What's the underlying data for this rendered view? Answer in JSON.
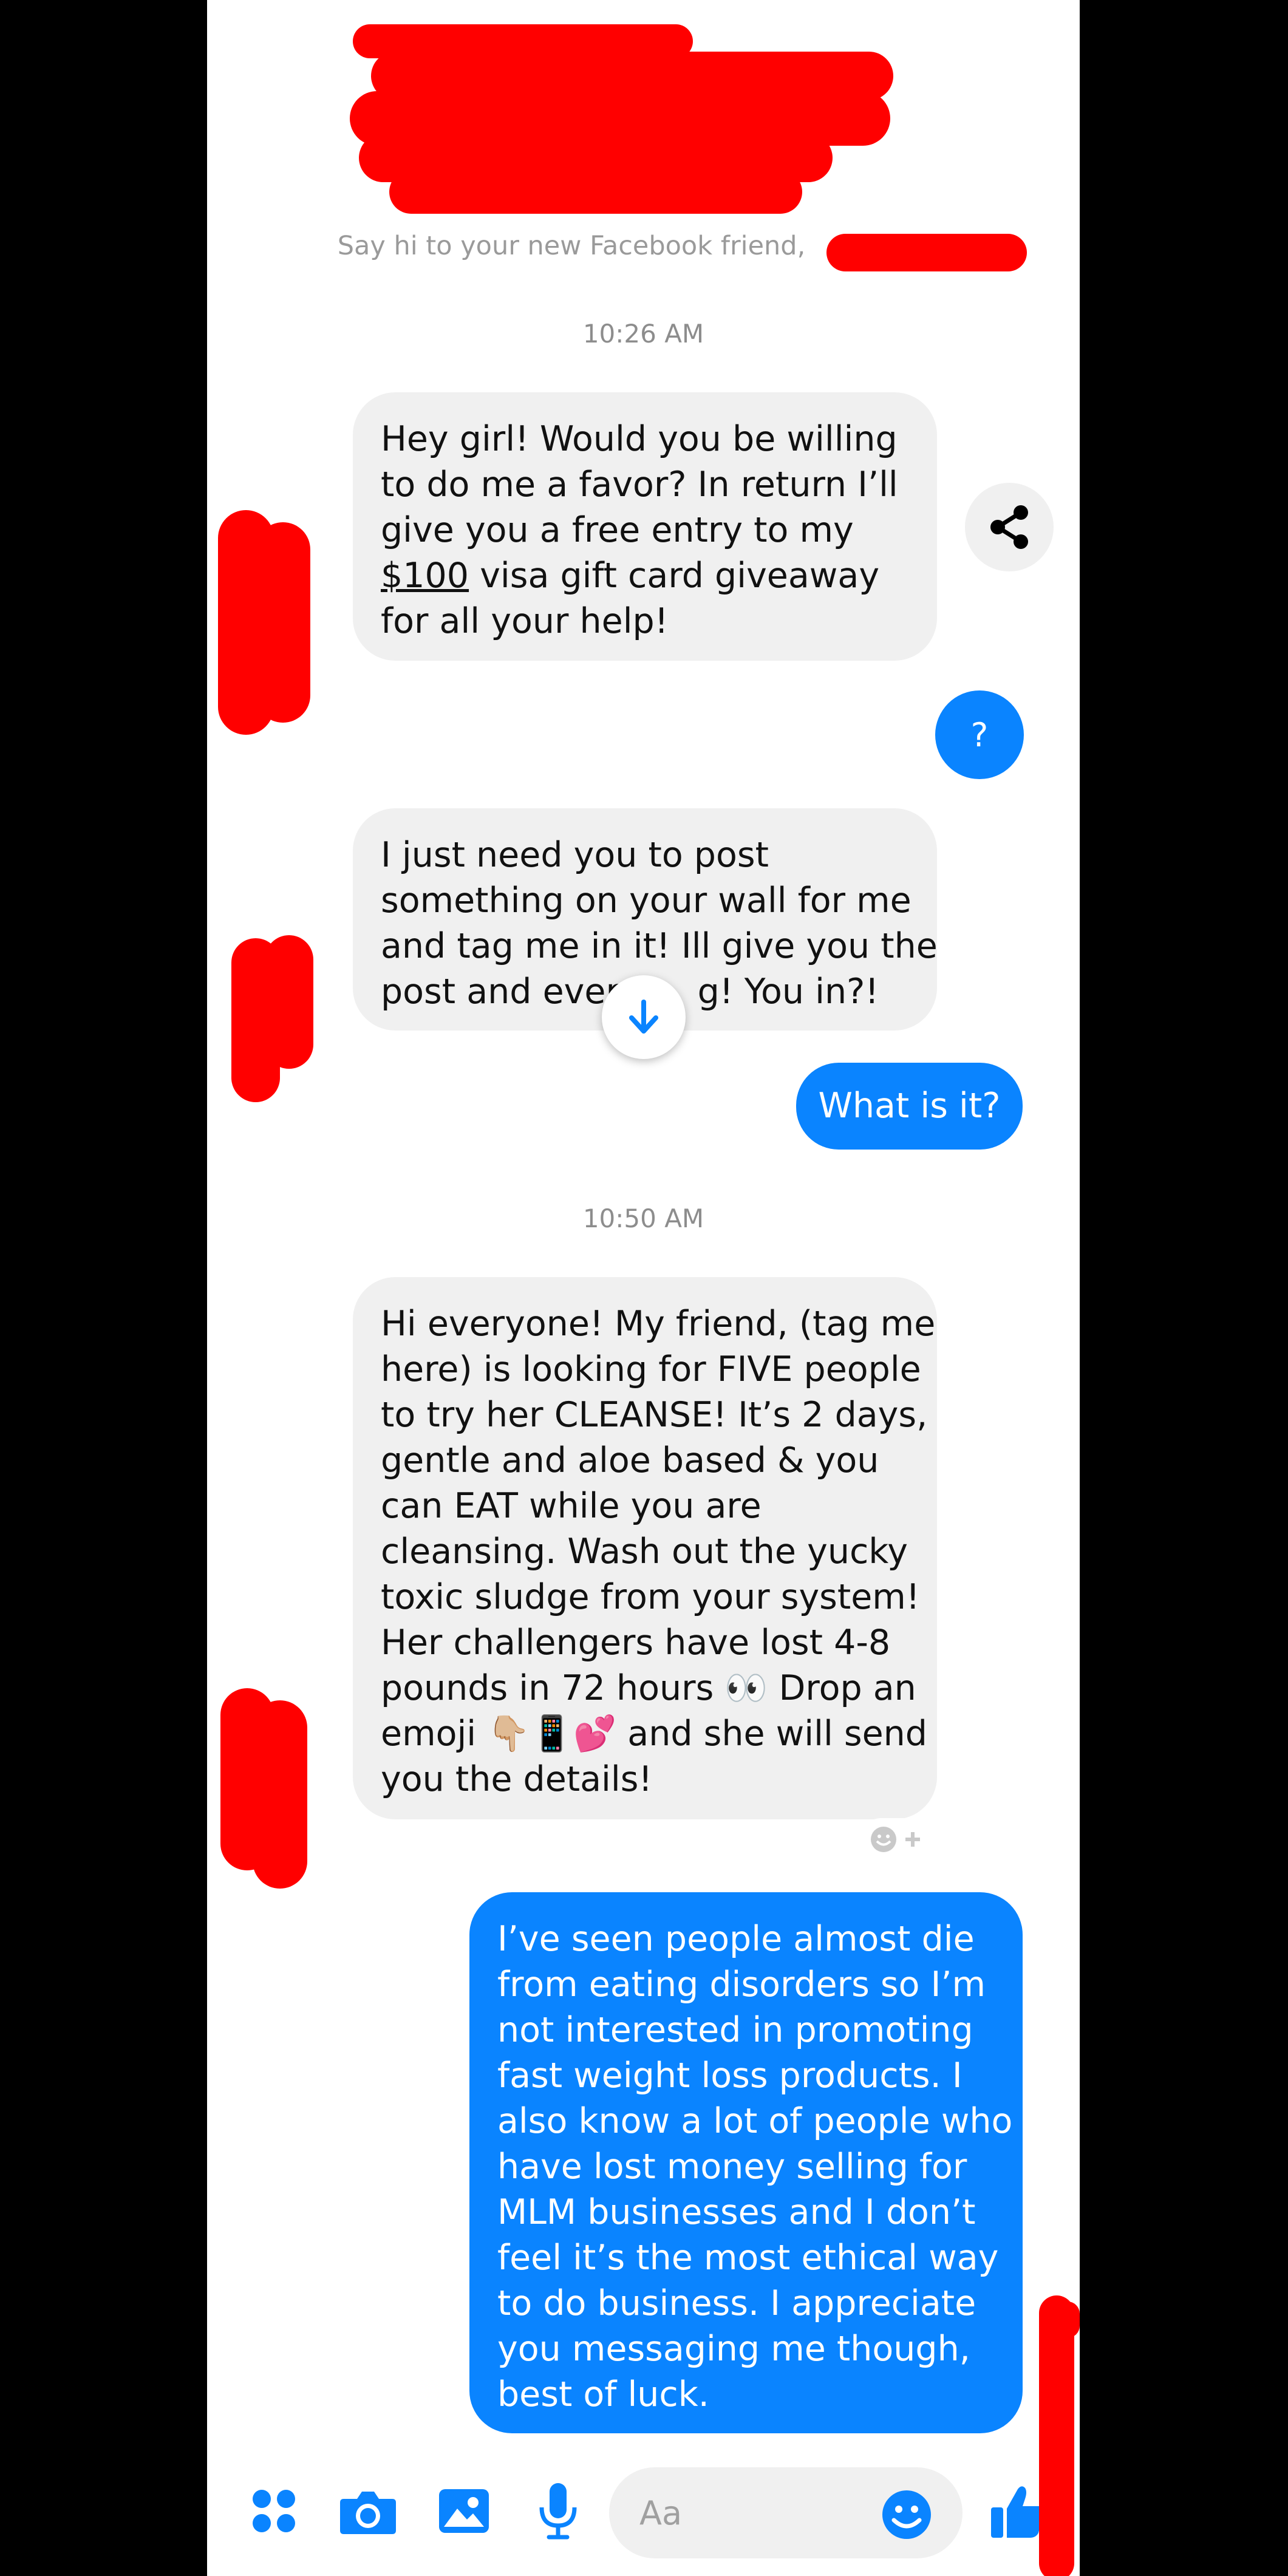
{
  "header": {
    "say_hi": "Say hi to your new Facebook friend,"
  },
  "timestamps": {
    "first": "10:26 AM",
    "second": "10:50 AM"
  },
  "messages": {
    "m1_lines": [
      "Hey girl! Would you be willing",
      "to do me a favor? In return I’ll",
      "give you a free entry to my",
      "visa gift card giveaway",
      "for all your help!"
    ],
    "m1_amount": "$100",
    "m2_reply": "?",
    "m3_lines": [
      "I just need you to post",
      "something on your wall for me",
      "and tag me in it! Ill give you the",
      "post and every",
      "g! You in?!"
    ],
    "m4_reply": "What is it?",
    "m5_lines": [
      "Hi everyone! My friend, (tag me",
      "here) is looking for FIVE people",
      "to try her CLEANSE!  It’s 2 days,",
      "gentle and aloe based & you",
      "can EAT while you are",
      "cleansing. Wash out the yucky",
      "toxic sludge from your system!",
      "Her challengers have lost 4-8",
      "pounds in 72 hours 👀 Drop an",
      "emoji 👇🏼📱💕 and she will send",
      "you the details!"
    ],
    "m6_lines": [
      "I’ve seen people almost die",
      "from eating disorders so I’m",
      "not interested in promoting",
      "fast weight loss products. I",
      "also know a lot of people who",
      "have lost money selling for",
      "MLM businesses and I don’t",
      "feel it’s the most ethical way",
      "to do business. I appreciate",
      "you messaging me though,",
      "best of luck."
    ]
  },
  "composer": {
    "placeholder": "Aa"
  },
  "icons": {
    "apps": "apps-icon",
    "camera": "camera-icon",
    "gallery": "image-icon",
    "mic": "microphone-icon",
    "emoji": "emoji-icon",
    "like": "thumbs-up-icon",
    "share": "share-icon",
    "scroll": "arrow-down-icon",
    "react": "add-reaction-icon"
  },
  "colors": {
    "accent": "#0a84ff",
    "incoming_bubble": "#f0f0f0",
    "redaction": "#ff0000"
  }
}
